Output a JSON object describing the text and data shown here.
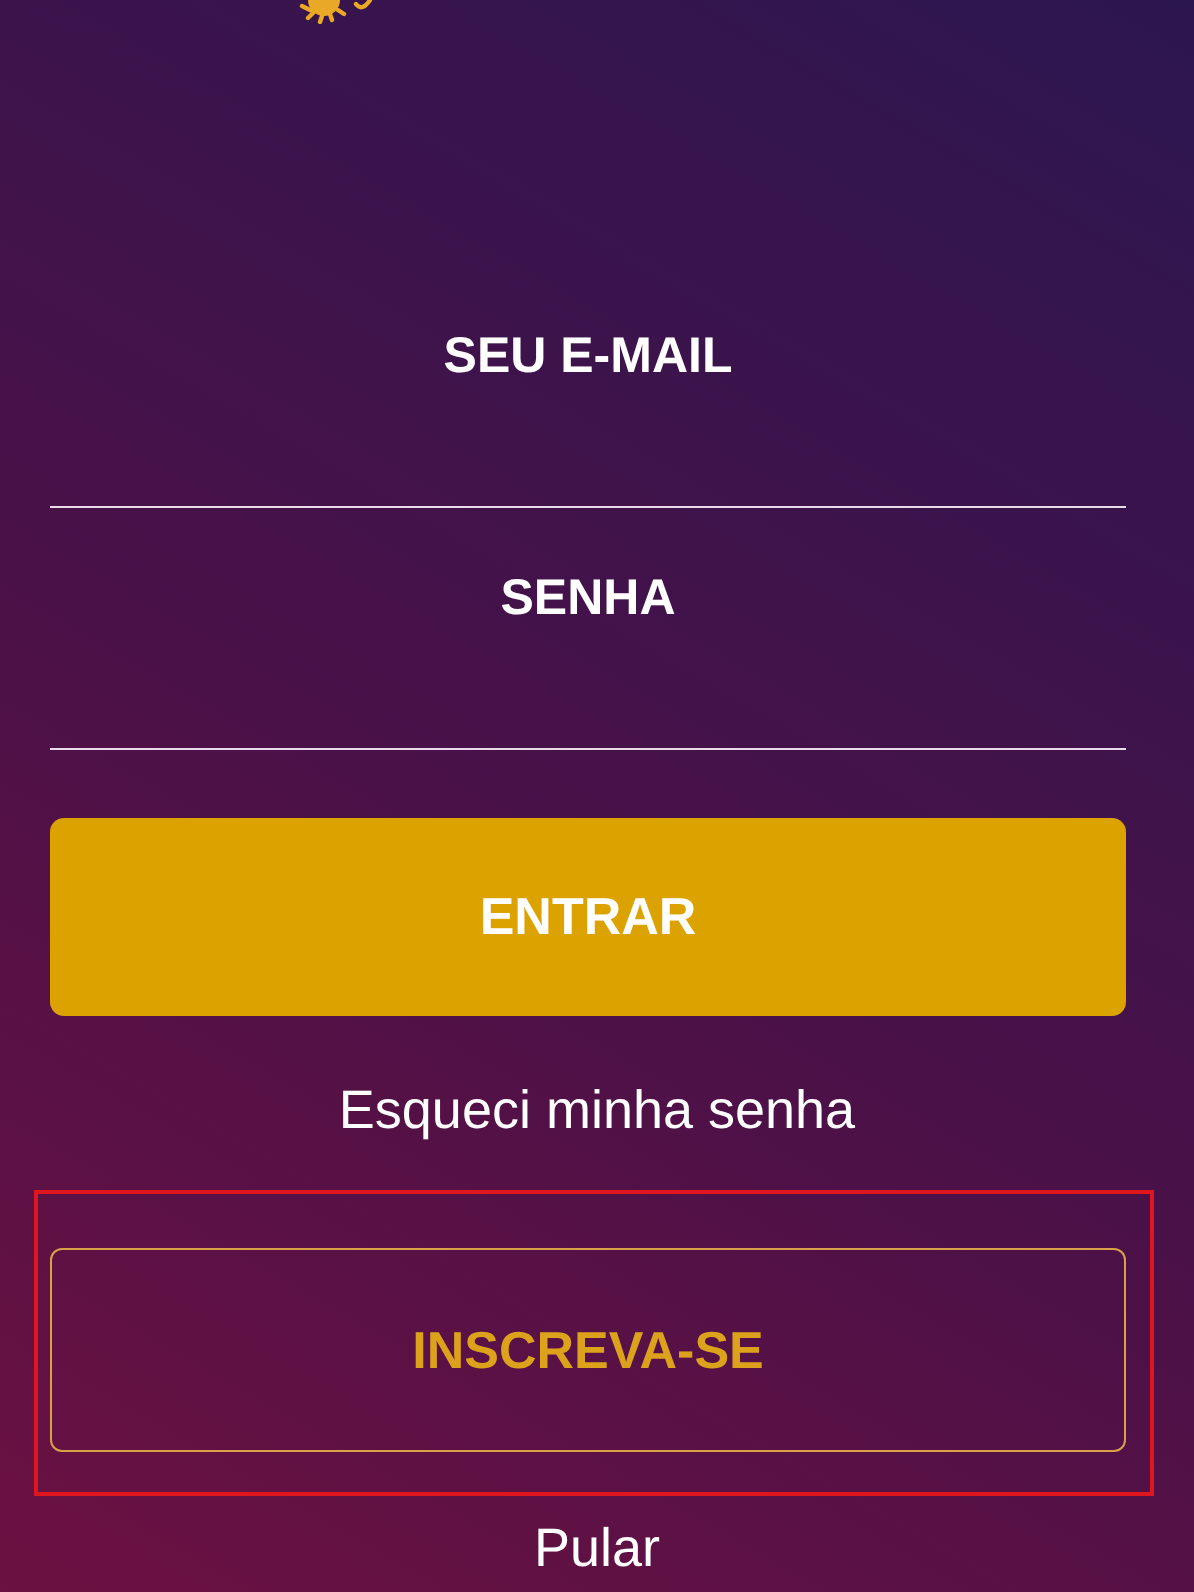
{
  "email_field": {
    "placeholder": "SEU E-MAIL"
  },
  "password_field": {
    "placeholder": "SENHA"
  },
  "login_button": {
    "label": "ENTRAR"
  },
  "forgot_link": {
    "label": "Esqueci minha senha"
  },
  "signup_button": {
    "label": "INSCREVA-SE",
    "highlighted": true
  },
  "skip_link": {
    "label": "Pular"
  }
}
